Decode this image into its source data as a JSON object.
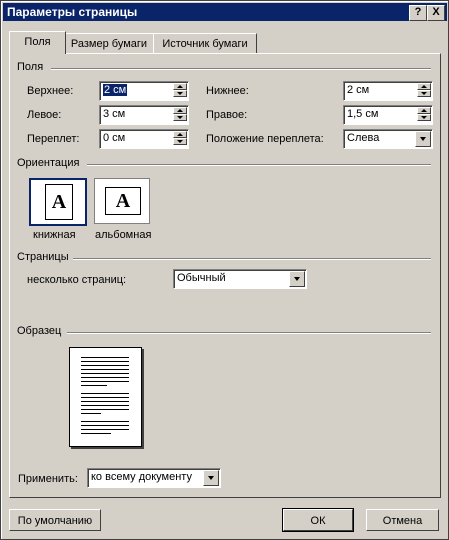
{
  "window": {
    "title": "Параметры страницы",
    "help_label": "?",
    "close_label": "X"
  },
  "tabs": [
    "Поля",
    "Размер бумаги",
    "Источник бумаги"
  ],
  "margins": {
    "group_label": "Поля",
    "top_label": "Верхнее:",
    "top_value": "2 см",
    "left_label": "Левое:",
    "left_value": "3 см",
    "gutter_label": "Переплет:",
    "gutter_value": "0 см",
    "bottom_label": "Нижнее:",
    "bottom_value": "2 см",
    "right_label": "Правое:",
    "right_value": "1,5 см",
    "gutter_pos_label": "Положение переплета:",
    "gutter_pos_value": "Слева"
  },
  "orientation": {
    "group_label": "Ориентация",
    "portrait_label": "книжная",
    "landscape_label": "альбомная",
    "icon_letter": "A",
    "selected": "portrait"
  },
  "pages": {
    "group_label": "Страницы",
    "multiple_label": "несколько страниц:",
    "multiple_value": "Обычный"
  },
  "preview": {
    "group_label": "Образец",
    "apply_label": "Применить:",
    "apply_value": "ко всему документу"
  },
  "buttons": {
    "default": "По умолчанию",
    "ok": "ОК",
    "cancel": "Отмена"
  }
}
